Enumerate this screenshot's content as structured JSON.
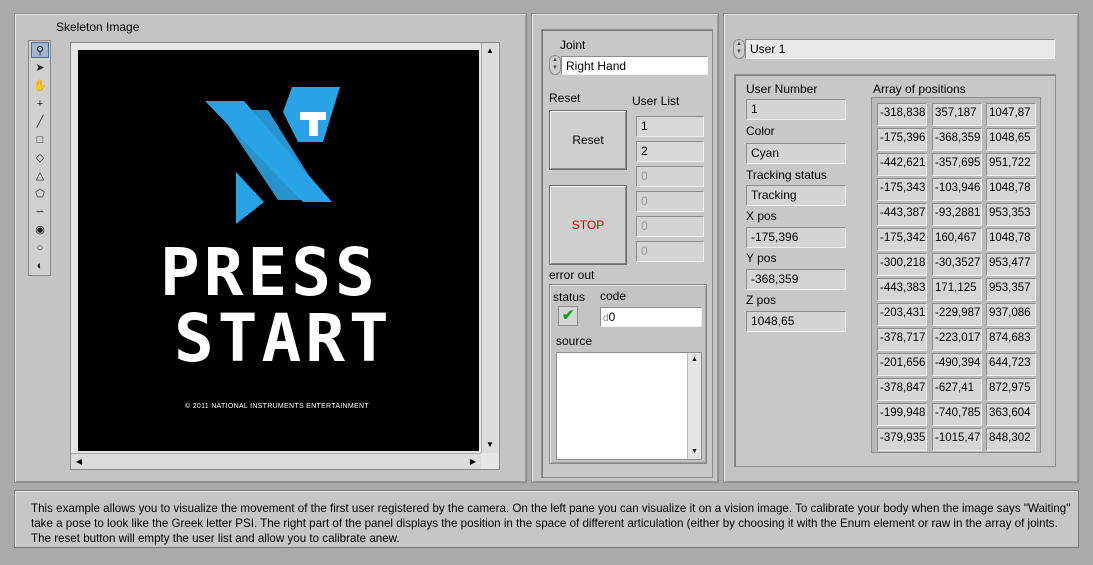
{
  "skeleton": {
    "title": "Skeleton Image",
    "logo_words": [
      "PRESS",
      "START"
    ],
    "copyright": "© 2011 NATIONAL INSTRUMENTS ENTERTAINMENT",
    "tools": [
      "zoom-icon",
      "pointer-icon",
      "pan-hand-icon",
      "crosshair-icon",
      "line-icon",
      "rectangle-icon",
      "rotated-rectangle-icon",
      "annulus-icon",
      "polygon-icon",
      "freehand-icon",
      "freehand-region-icon",
      "oval-icon",
      "rotated-annulus-icon"
    ]
  },
  "middle": {
    "joint_label": "Joint",
    "joint_value": "Right Hand",
    "reset_label": "Reset",
    "reset_button": "Reset",
    "stop_button": "STOP",
    "user_list_label": "User List",
    "user_list": [
      "1",
      "2",
      "0",
      "0",
      "0",
      "0"
    ],
    "error_out_label": "error out",
    "status_label": "status",
    "code_label": "code",
    "code_prefix": "d",
    "code_value": "0",
    "source_label": "source"
  },
  "right": {
    "user_value": "User 1",
    "user_number_label": "User Number",
    "user_number": "1",
    "color_label": "Color",
    "color_value": "Cyan",
    "tracking_label": "Tracking status",
    "tracking_value": "Tracking",
    "xpos_label": "X pos",
    "xpos": "-175,396",
    "ypos_label": "Y pos",
    "ypos": "-368,359",
    "zpos_label": "Z pos",
    "zpos": "1048,65",
    "array_label": "Array of positions",
    "positions": [
      [
        "-318,838",
        "357,187",
        "1047,87"
      ],
      [
        "-175,396",
        "-368,359",
        "1048,65"
      ],
      [
        "-442,621",
        "-357,695",
        "951,722"
      ],
      [
        "-175,343",
        "-103,946",
        "1048,78"
      ],
      [
        "-443,387",
        "-93,2881",
        "953,353"
      ],
      [
        "-175,342",
        "160,467",
        "1048,78"
      ],
      [
        "-300,218",
        "-30,3527",
        "953,477"
      ],
      [
        "-443,383",
        "171,125",
        "953,357"
      ],
      [
        "-203,431",
        "-229,987",
        "937,086"
      ],
      [
        "-378,717",
        "-223,017",
        "874,683"
      ],
      [
        "-201,656",
        "-490,394",
        "644,723"
      ],
      [
        "-378,847",
        "-627,41",
        "872,975"
      ],
      [
        "-199,948",
        "-740,785",
        "363,604"
      ],
      [
        "-379,935",
        "-1015,47",
        "848,302"
      ]
    ]
  },
  "description": "This example allows you to visualize the movement of the first user registered by the camera. On the left pane you can visualize it on a vision image. To calibrate your body when the image says \"Waiting\" take a pose to look like the Greek letter PSI. The right part  of the panel displays the position in the space of different articulation (either by  choosing  it with the Enum element or raw in the array of joints. The reset button will  empty the user  list and allow you to calibrate anew.",
  "colors": {
    "logo_blue": "#2aa3e6",
    "logo_white": "#ffffff",
    "stop_red": "#d00000",
    "status_green": "#1e9a1e"
  }
}
